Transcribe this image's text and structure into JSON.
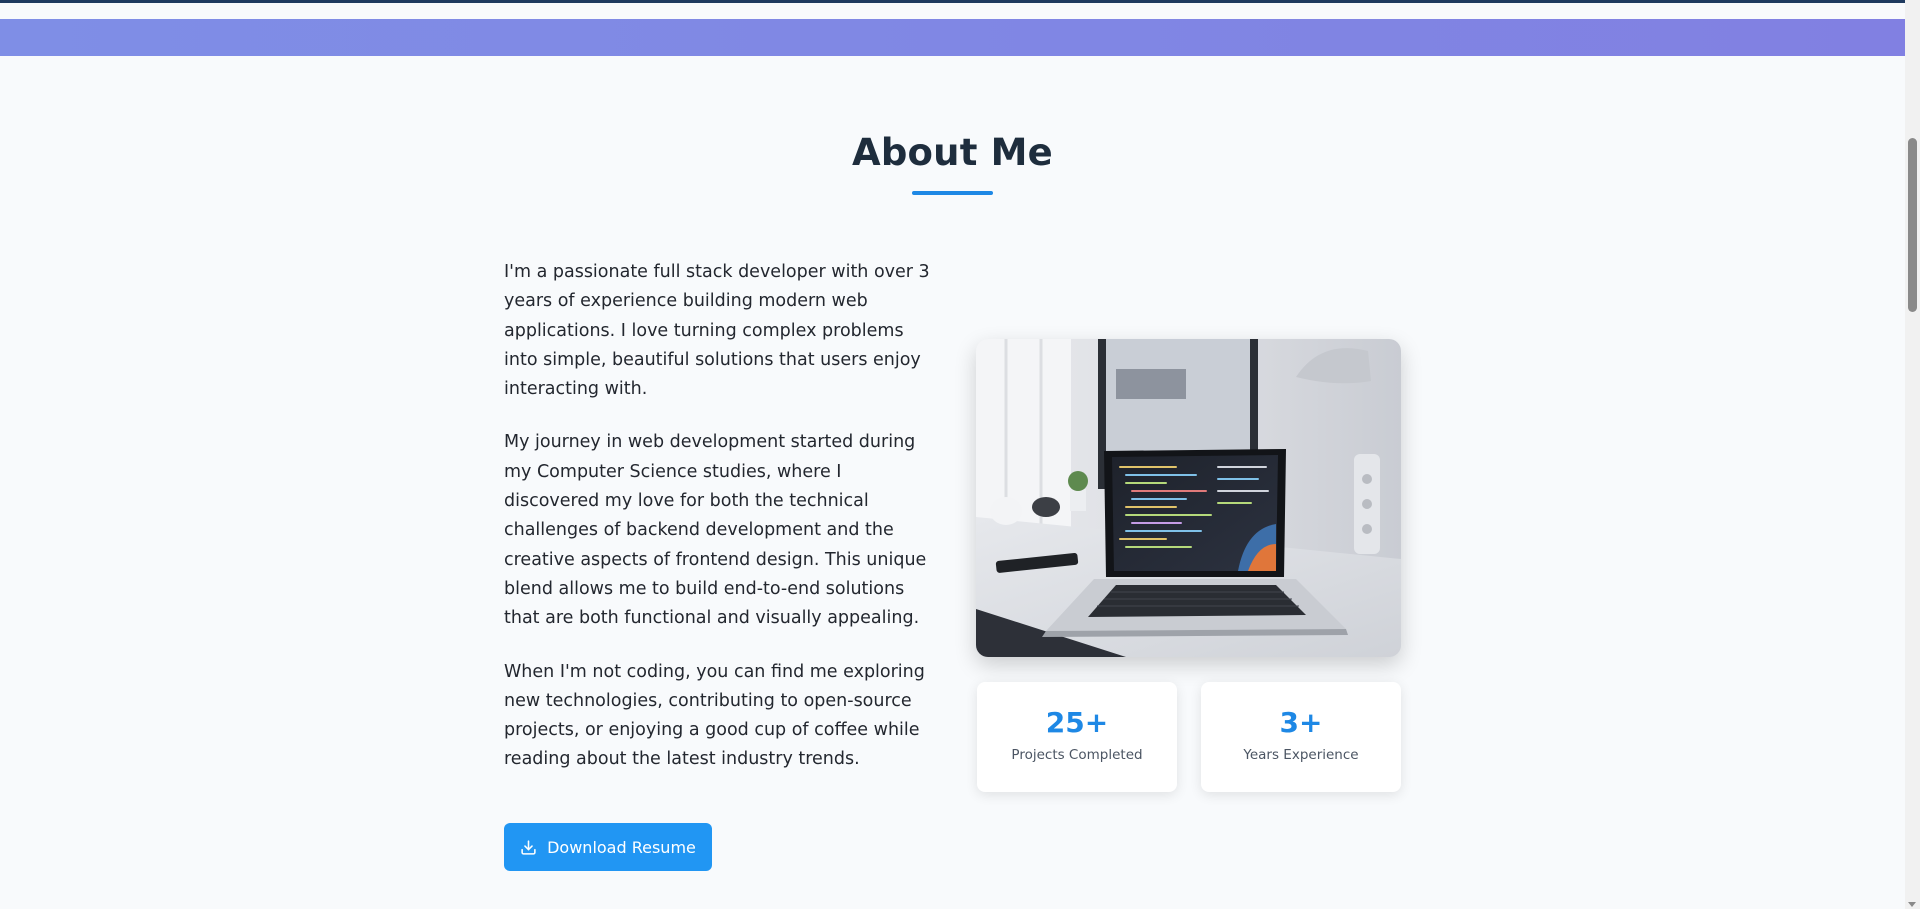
{
  "about": {
    "title": "About Me",
    "paragraphs": [
      "I'm a passionate full stack developer with over 3 years of experience building modern web applications. I love turning complex problems into simple, beautiful solutions that users enjoy interacting with.",
      "My journey in web development started during my Computer Science studies, where I discovered my love for both the technical challenges of backend development and the creative aspects of frontend design. This unique blend allows me to build end-to-end solutions that are both functional and visually appealing.",
      "When I'm not coding, you can find me exploring new technologies, contributing to open-source projects, or enjoying a good cup of coffee while reading about the latest industry trends."
    ],
    "resume_button_label": "Download Resume",
    "resume_icon": "download-icon",
    "image_alt": "laptop-on-desk-photo"
  },
  "stats": [
    {
      "value": "25+",
      "label": "Projects Completed"
    },
    {
      "value": "3+",
      "label": "Years Experience"
    }
  ],
  "colors": {
    "accent": "#2196f3",
    "title": "#1e2d3d",
    "hero_gradient_start": "#7f8ee6",
    "hero_gradient_end": "#8180e2",
    "background": "#f8fafc"
  }
}
